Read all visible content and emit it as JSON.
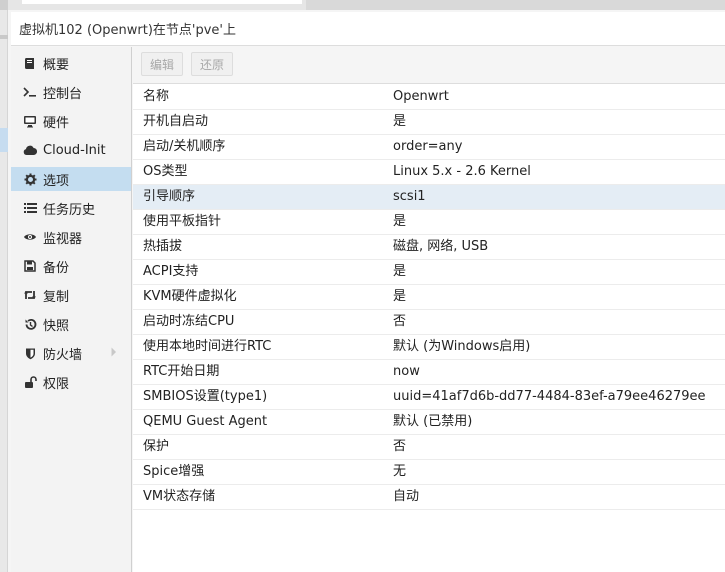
{
  "window": {
    "title": "虚拟机102 (Openwrt)在节点'pve'上"
  },
  "sidebar": {
    "items": [
      {
        "label": "概要",
        "icon": "book-icon"
      },
      {
        "label": "控制台",
        "icon": "terminal-icon"
      },
      {
        "label": "硬件",
        "icon": "desktop-icon"
      },
      {
        "label": "Cloud-Init",
        "icon": "cloud-icon"
      },
      {
        "label": "选项",
        "icon": "gear-icon",
        "active": true
      },
      {
        "label": "任务历史",
        "icon": "list-icon"
      },
      {
        "label": "监视器",
        "icon": "eye-icon"
      },
      {
        "label": "备份",
        "icon": "floppy-icon"
      },
      {
        "label": "复制",
        "icon": "retweet-icon"
      },
      {
        "label": "快照",
        "icon": "history-icon"
      },
      {
        "label": "防火墙",
        "icon": "shield-icon",
        "has_submenu": true
      },
      {
        "label": "权限",
        "icon": "unlock-icon"
      }
    ]
  },
  "toolbar": {
    "edit_label": "编辑",
    "revert_label": "还原"
  },
  "options": [
    {
      "key": "名称",
      "value": "Openwrt"
    },
    {
      "key": "开机自启动",
      "value": "是"
    },
    {
      "key": "启动/关机顺序",
      "value": "order=any"
    },
    {
      "key": "OS类型",
      "value": "Linux 5.x - 2.6 Kernel"
    },
    {
      "key": "引导顺序",
      "value": "scsi1",
      "selected": true
    },
    {
      "key": "使用平板指针",
      "value": "是"
    },
    {
      "key": "热插拔",
      "value": "磁盘, 网络, USB"
    },
    {
      "key": "ACPI支持",
      "value": "是"
    },
    {
      "key": "KVM硬件虚拟化",
      "value": "是"
    },
    {
      "key": "启动时冻结CPU",
      "value": "否"
    },
    {
      "key": "使用本地时间进行RTC",
      "value": "默认 (为Windows启用)"
    },
    {
      "key": "RTC开始日期",
      "value": "now"
    },
    {
      "key": "SMBIOS设置(type1)",
      "value": "uuid=41af7d6b-dd77-4484-83ef-a79ee46279ee"
    },
    {
      "key": "QEMU Guest Agent",
      "value": "默认 (已禁用)"
    },
    {
      "key": "保护",
      "value": "否"
    },
    {
      "key": "Spice增强",
      "value": "无"
    },
    {
      "key": "VM状态存储",
      "value": "自动"
    }
  ],
  "colors": {
    "active_item_bg": "#c4ddf0",
    "selected_row_bg": "#e4edf5",
    "disabled_text": "#a8a8a8"
  }
}
